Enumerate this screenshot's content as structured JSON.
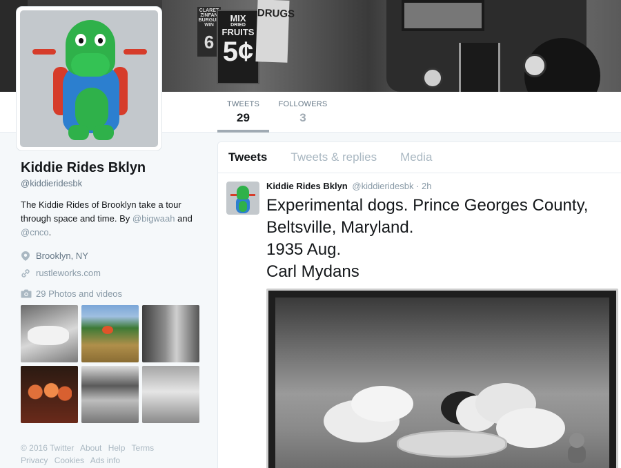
{
  "profile": {
    "name": "Kiddie Rides Bklyn",
    "handle": "@kiddieridesbk",
    "bio_text_1": "The Kiddie Rides of Brooklyn take a tour through space and time. By ",
    "bio_link_1": "@bigwaah",
    "bio_text_2": " and ",
    "bio_link_2": "@cnco",
    "bio_text_3": ".",
    "location": "Brooklyn, NY",
    "website": "rustleworks.com"
  },
  "stats": {
    "tweets_label": "TWEETS",
    "tweets_value": "29",
    "followers_label": "FOLLOWERS",
    "followers_value": "3"
  },
  "photos": {
    "title": "29 Photos and videos"
  },
  "banner": {
    "sign_claret_top": "CLARET ZINFAN BURGUN WIN",
    "sign_claret_num": "6",
    "sign_fruit_1": "MIX",
    "sign_fruit_2": "DRIED",
    "sign_fruit_3": "FRUITS",
    "sign_fruit_price": "5¢",
    "sign_drugs": "DRUGS"
  },
  "timeline": {
    "tabs": [
      {
        "label": "Tweets"
      },
      {
        "label": "Tweets & replies"
      },
      {
        "label": "Media"
      }
    ],
    "tweet": {
      "author": "Kiddie Rides Bklyn",
      "handle_time": "@kiddieridesbk · 2h",
      "lines": [
        "Experimental dogs. Prince Georges County,",
        "Beltsville, Maryland.",
        "1935 Aug.",
        "Carl Mydans"
      ]
    }
  },
  "footer": {
    "links": [
      "© 2016 Twitter",
      "About",
      "Help",
      "Terms",
      "Privacy",
      "Cookies",
      "Ads info"
    ]
  },
  "colors": {
    "link": "#8899a6",
    "accent_underline": "#a0aab3",
    "croc_green": "#2fb14a",
    "croc_blue": "#2c7fcf",
    "croc_red": "#d63c2a"
  },
  "icons": {
    "location": "map-pin-icon",
    "website": "link-icon",
    "photos": "camera-icon"
  }
}
